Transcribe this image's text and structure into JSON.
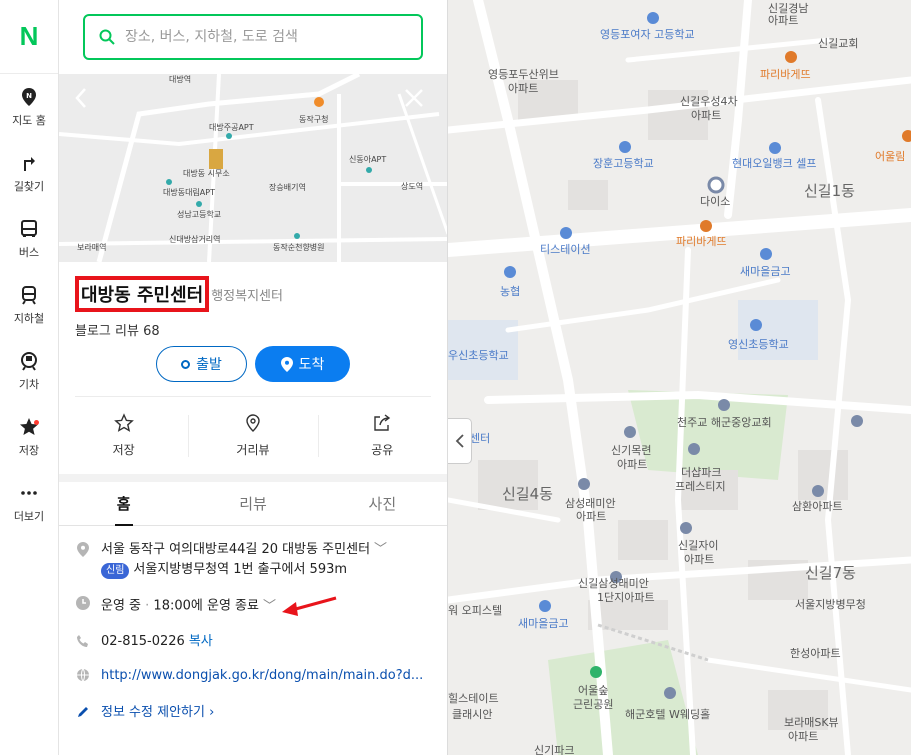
{
  "rail": {
    "logo": "N",
    "items": [
      {
        "label": "지도 홈"
      },
      {
        "label": "길찾기"
      },
      {
        "label": "버스"
      },
      {
        "label": "지하철"
      },
      {
        "label": "기차"
      },
      {
        "label": "저장"
      },
      {
        "label": "더보기"
      }
    ]
  },
  "search": {
    "placeholder": "장소, 버스, 지하철, 도로 검색"
  },
  "thumb_map": {
    "labels": [
      "대방역",
      "동작구청",
      "대방주공APT",
      "신동아APT",
      "대방동 시무소",
      "대방동대림APT",
      "장승배기역",
      "상도역",
      "성남고등학교",
      "신대방삼거리역",
      "보라매역",
      "동작순천향병원"
    ]
  },
  "place": {
    "name": "대방동 주민센터",
    "category": "행정복지센터",
    "reviews": "블로그 리뷰 68"
  },
  "route": {
    "start": "출발",
    "arrive": "도착"
  },
  "actions": [
    {
      "label": "저장"
    },
    {
      "label": "거리뷰"
    },
    {
      "label": "공유"
    }
  ],
  "tabs": [
    {
      "label": "홈"
    },
    {
      "label": "리뷰"
    },
    {
      "label": "사진"
    }
  ],
  "info": {
    "address": "서울 동작구 여의대방로44길 20 대방동 주민센터",
    "line_badge": "신림",
    "transit": "서울지방병무청역 1번 출구에서 593m",
    "hours_status": "운영 중",
    "hours_end": "18:00에 운영 종료",
    "phone": "02-815-0226",
    "copy": "복사",
    "url": "http://www.dongjak.go.kr/dong/main/main.do?d...",
    "suggest": "정보 수정 제안하기"
  },
  "map": {
    "labels": [
      {
        "text": "영등포여자 고등학교",
        "cls": "blue"
      },
      {
        "text": "신길경남",
        "cls": "grey"
      },
      {
        "text": "아파트",
        "cls": "grey"
      },
      {
        "text": "신길교회",
        "cls": "grey"
      },
      {
        "text": "영등포두산위브",
        "cls": "grey"
      },
      {
        "text": "아파트",
        "cls": "grey"
      },
      {
        "text": "파리바게뜨",
        "cls": "orange"
      },
      {
        "text": "신길우성4차",
        "cls": "grey"
      },
      {
        "text": "아파트",
        "cls": "grey"
      },
      {
        "text": "어울림",
        "cls": "orange"
      },
      {
        "text": "장훈고등학교",
        "cls": "blue"
      },
      {
        "text": "현대오일뱅크 셀프",
        "cls": "blue"
      },
      {
        "text": "다이소",
        "cls": "grey"
      },
      {
        "text": "신길1동",
        "cls": "area"
      },
      {
        "text": "파리바게뜨",
        "cls": "orange"
      },
      {
        "text": "티스테이션",
        "cls": "blue"
      },
      {
        "text": "새마을금고",
        "cls": "blue"
      },
      {
        "text": "농협",
        "cls": "blue"
      },
      {
        "text": "우신초등학교",
        "cls": "blue"
      },
      {
        "text": "영신초등학교",
        "cls": "blue"
      },
      {
        "text": "천주교 해군중앙교회",
        "cls": "grey"
      },
      {
        "text": "센터",
        "cls": "blue"
      },
      {
        "text": "신기목련",
        "cls": "grey"
      },
      {
        "text": "아파트",
        "cls": "grey"
      },
      {
        "text": "더샵파크",
        "cls": "grey"
      },
      {
        "text": "프레스티지",
        "cls": "grey"
      },
      {
        "text": "신길4동",
        "cls": "area"
      },
      {
        "text": "삼성래미안",
        "cls": "grey"
      },
      {
        "text": "아파트",
        "cls": "grey"
      },
      {
        "text": "삼환아파트",
        "cls": "grey"
      },
      {
        "text": "신길자이",
        "cls": "grey"
      },
      {
        "text": "아파트",
        "cls": "grey"
      },
      {
        "text": "신길7동",
        "cls": "area"
      },
      {
        "text": "신길삼성래미안",
        "cls": "grey"
      },
      {
        "text": "1단지아파트",
        "cls": "grey"
      },
      {
        "text": "서울지방병무청",
        "cls": "grey"
      },
      {
        "text": "워 오피스텔",
        "cls": "grey"
      },
      {
        "text": "새마을금고",
        "cls": "blue"
      },
      {
        "text": "한성아파트",
        "cls": "grey"
      },
      {
        "text": "어울숲",
        "cls": "grey"
      },
      {
        "text": "근린공원",
        "cls": "grey"
      },
      {
        "text": "힐스테이트",
        "cls": "grey"
      },
      {
        "text": "클래시안",
        "cls": "grey"
      },
      {
        "text": "해군호텔 W웨딩홀",
        "cls": "grey"
      },
      {
        "text": "보라매SK뷰",
        "cls": "grey"
      },
      {
        "text": "아파트",
        "cls": "grey"
      },
      {
        "text": "신기파크",
        "cls": "grey"
      }
    ]
  },
  "colors": {
    "brand": "#03c75a",
    "accent": "#0b7df0",
    "highlight": "#e8141b"
  }
}
